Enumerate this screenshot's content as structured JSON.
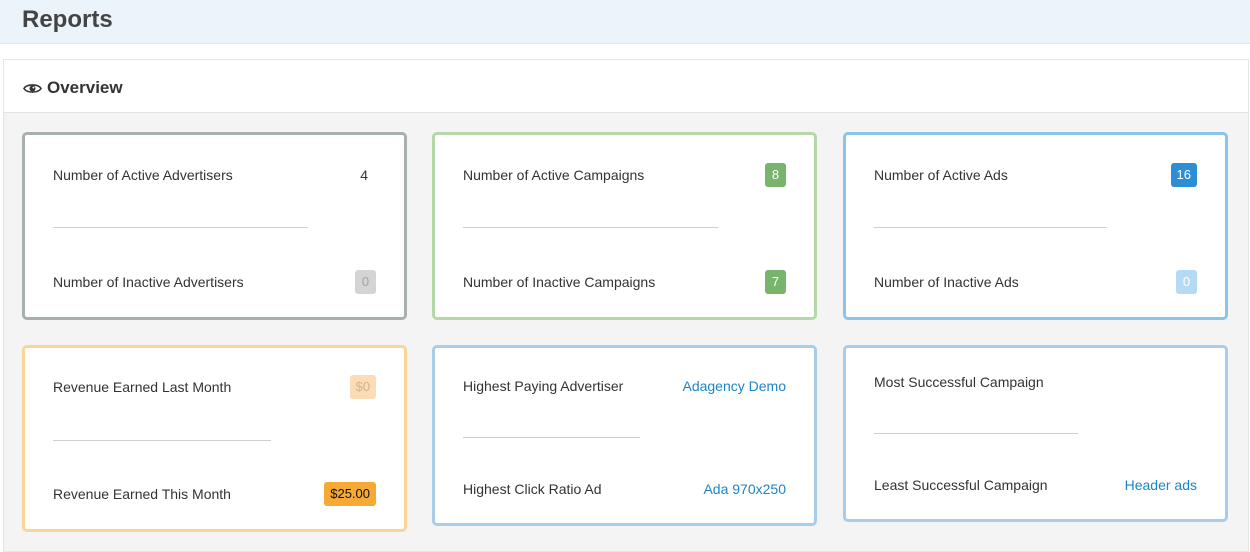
{
  "header": {
    "title": "Reports"
  },
  "panel": {
    "title": "Overview",
    "icon": "eye-icon"
  },
  "cards": {
    "advertisers": {
      "active_label": "Number of Active Advertisers",
      "active_value": "4",
      "inactive_label": "Number of Inactive Advertisers",
      "inactive_value": "0"
    },
    "campaigns": {
      "active_label": "Number of Active Campaigns",
      "active_value": "8",
      "inactive_label": "Number of Inactive Campaigns",
      "inactive_value": "7"
    },
    "ads": {
      "active_label": "Number of Active Ads",
      "active_value": "16",
      "inactive_label": "Number of Inactive Ads",
      "inactive_value": "0"
    },
    "revenue": {
      "last_month_label": "Revenue Earned Last Month",
      "last_month_value": "$0",
      "this_month_label": "Revenue Earned This Month",
      "this_month_value": "$25.00"
    },
    "highest": {
      "paying_label": "Highest Paying Advertiser",
      "paying_value": "Adagency Demo",
      "click_label": "Highest Click Ratio Ad",
      "click_value": "Ada 970x250"
    },
    "success": {
      "most_label": "Most Successful Campaign",
      "most_value": "",
      "least_label": "Least Successful Campaign",
      "least_value": "Header ads"
    }
  },
  "colors": {
    "header_bg": "#ecf4fb",
    "green_badge": "#78b46c",
    "blue_badge": "#2c8fd6",
    "orange_badge": "#f6a935",
    "link": "#1b85c7"
  }
}
